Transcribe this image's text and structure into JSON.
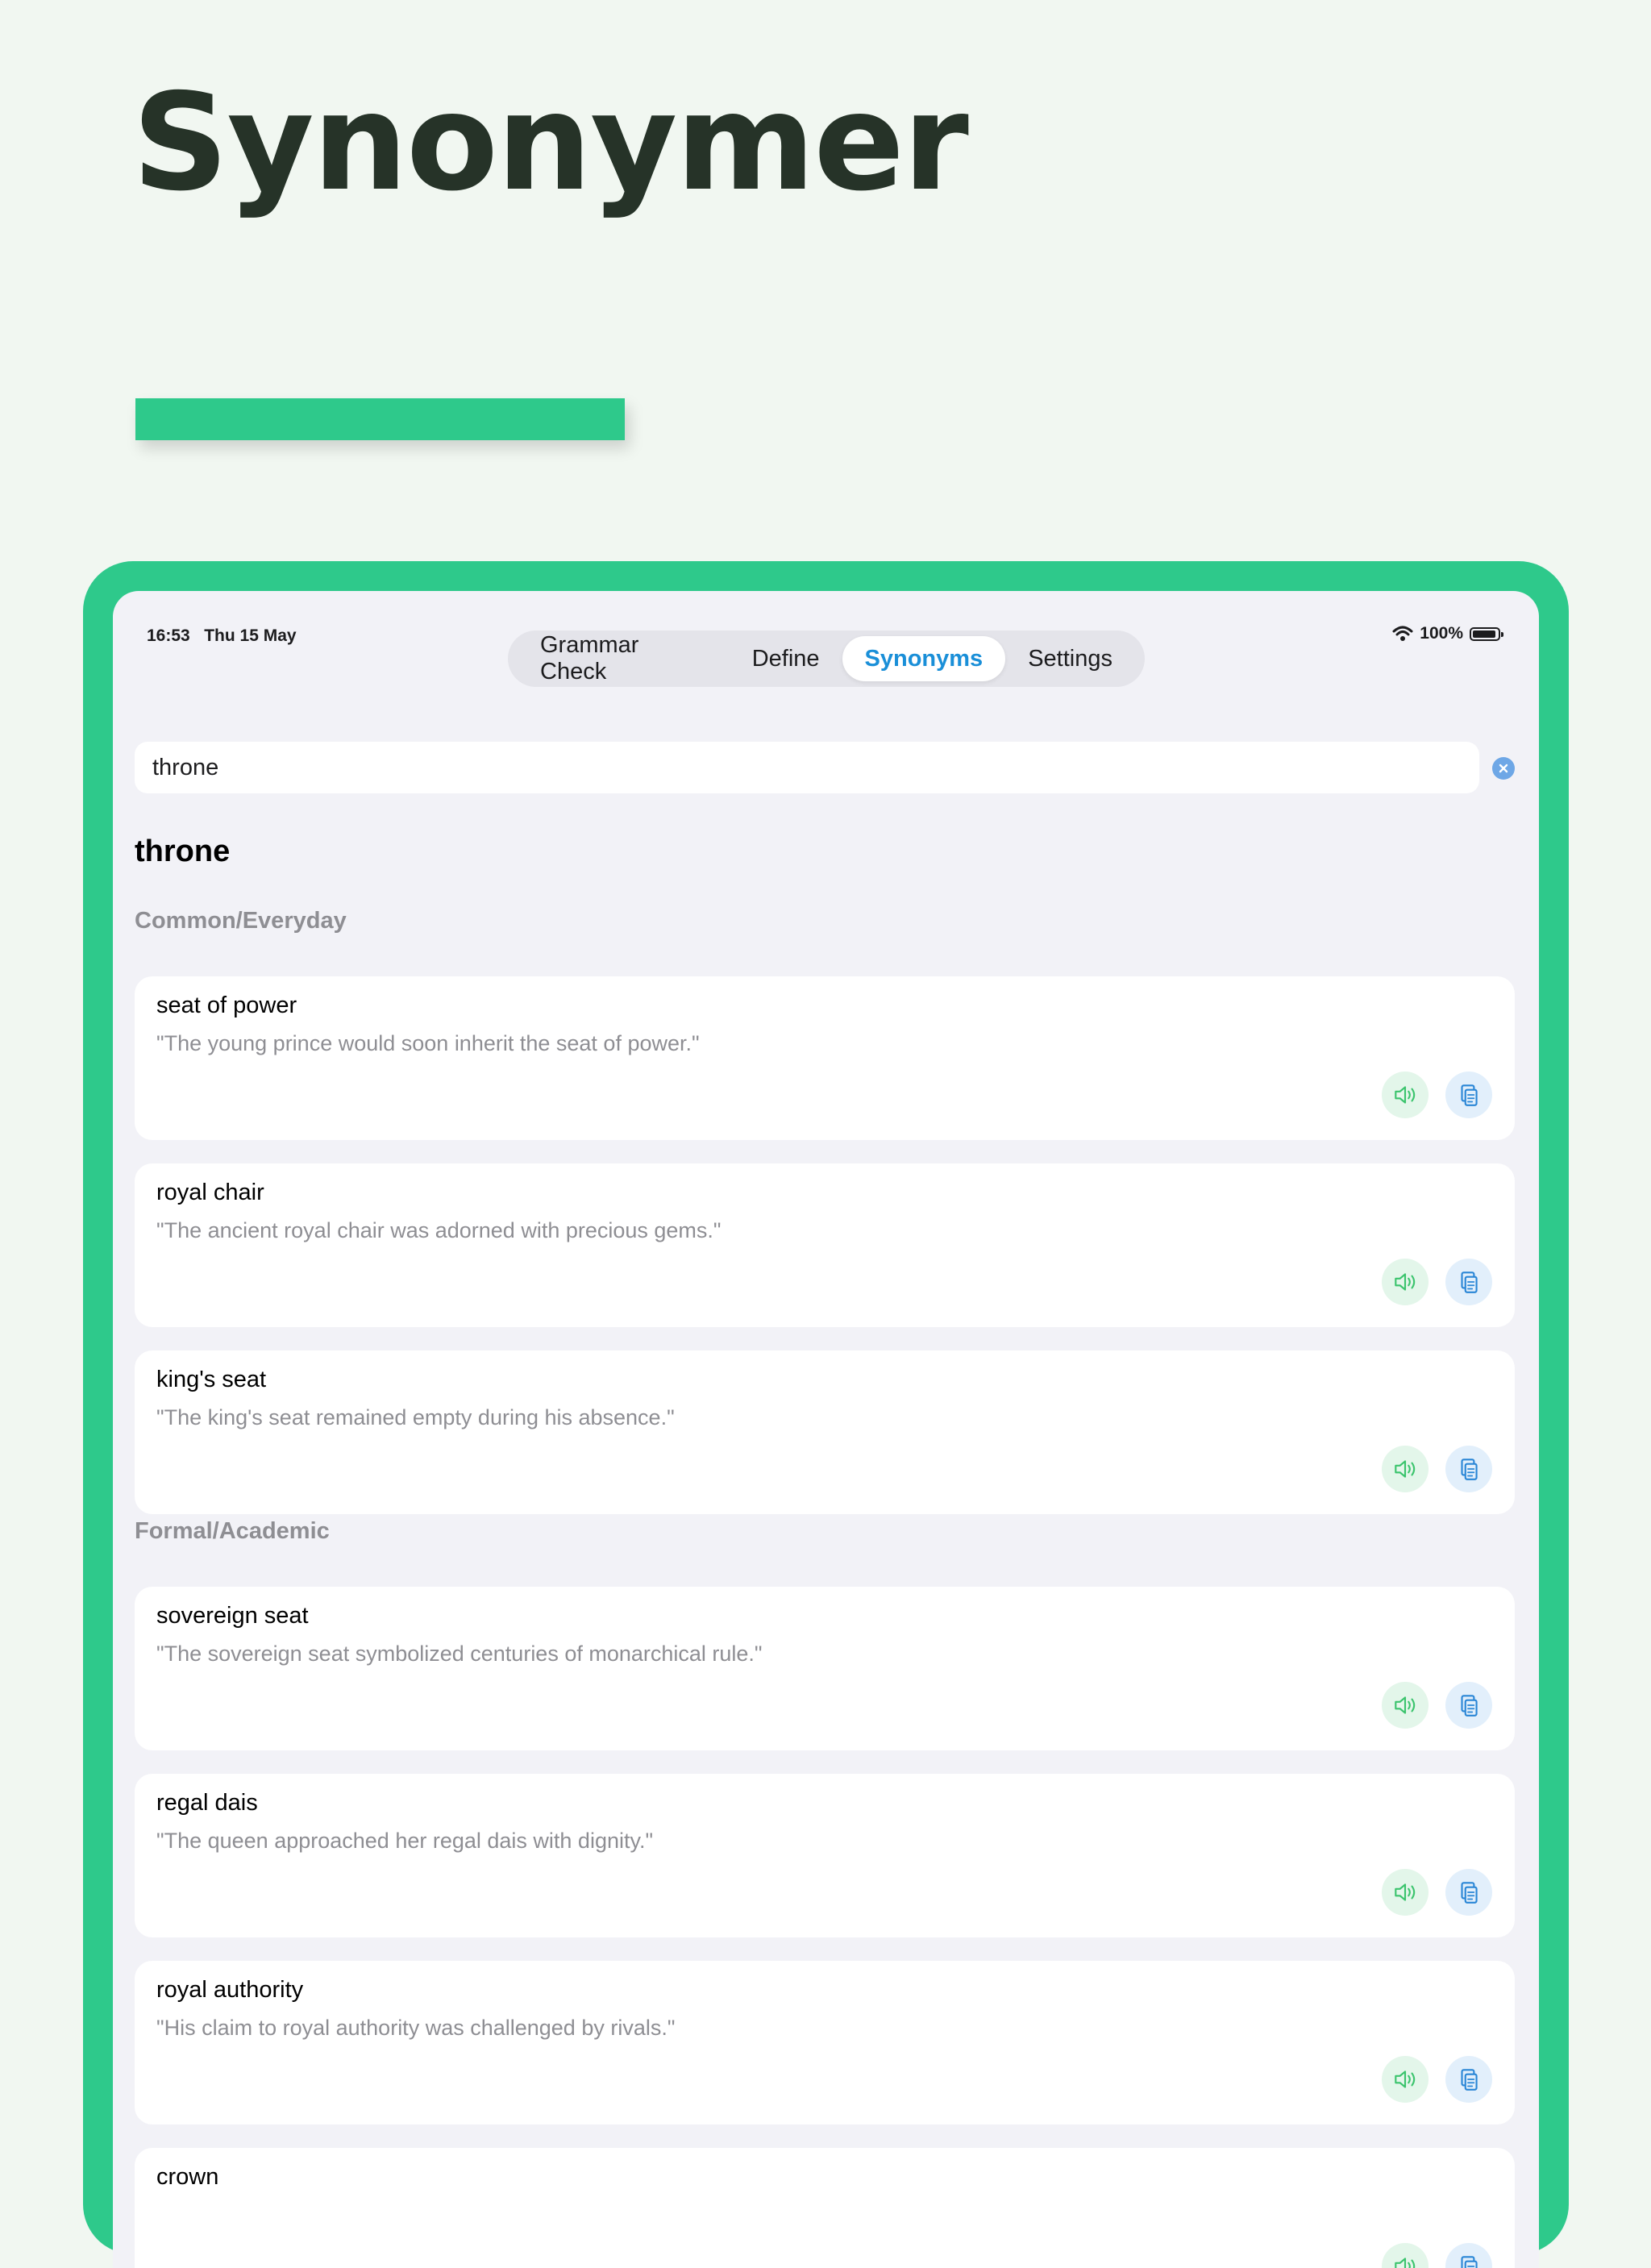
{
  "hero": {
    "title": "Synonymer"
  },
  "status_bar": {
    "time": "16:53",
    "date": "Thu 15 May",
    "battery": "100%"
  },
  "tabs": [
    {
      "label": "Grammar Check",
      "active": false
    },
    {
      "label": "Define",
      "active": false
    },
    {
      "label": "Synonyms",
      "active": true
    },
    {
      "label": "Settings",
      "active": false
    }
  ],
  "search": {
    "value": "throne",
    "placeholder": ""
  },
  "query_title": "throne",
  "sections": [
    {
      "header": "Common/Everyday",
      "items": [
        {
          "word": "seat of power",
          "example": "\"The young prince would soon inherit the seat of power.\""
        },
        {
          "word": "royal chair",
          "example": "\"The ancient royal chair was adorned with precious gems.\""
        },
        {
          "word": "king's seat",
          "example": "\"The king's seat remained empty during his absence.\""
        }
      ]
    },
    {
      "header": "Formal/Academic",
      "items": [
        {
          "word": "sovereign seat",
          "example": "\"The sovereign seat symbolized centuries of monarchical rule.\""
        },
        {
          "word": "regal dais",
          "example": "\"The queen approached her regal dais with dignity.\""
        },
        {
          "word": "royal authority",
          "example": "\"His claim to royal authority was challenged by rivals.\""
        },
        {
          "word": "crown",
          "example": ""
        }
      ]
    }
  ],
  "colors": {
    "accent_green": "#2ec98b",
    "tab_active": "#1a8fd8",
    "speak_icon": "#3bc46d",
    "copy_icon": "#2a86d6"
  },
  "icons": {
    "speak": "speaker-icon",
    "copy": "copy-icon",
    "clear": "clear-icon"
  }
}
